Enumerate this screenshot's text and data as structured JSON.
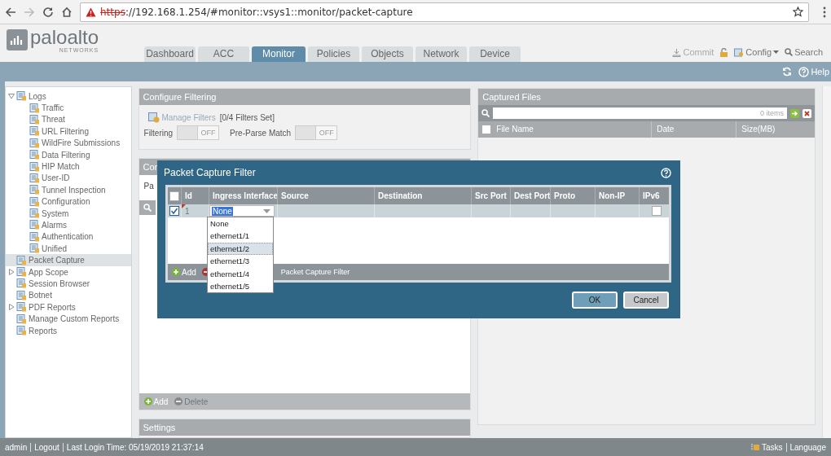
{
  "browser": {
    "url_scheme": "https",
    "url_rest": "://192.168.1.254/#monitor::vsys1::monitor/packet-capture",
    "secure": false
  },
  "header": {
    "logo": "paloalto",
    "logo_sub": "NETWORKS",
    "tabs": [
      {
        "label": "Dashboard",
        "selected": false
      },
      {
        "label": "ACC",
        "selected": false
      },
      {
        "label": "Monitor",
        "selected": true
      },
      {
        "label": "Policies",
        "selected": false
      },
      {
        "label": "Objects",
        "selected": false
      },
      {
        "label": "Network",
        "selected": false
      },
      {
        "label": "Device",
        "selected": false
      }
    ],
    "commit": {
      "label": "Commit",
      "disabled": true
    },
    "config": "Config",
    "search": "Search"
  },
  "help_bar": {
    "help": "Help"
  },
  "sidebar": {
    "items": [
      {
        "label": "Logs",
        "expanded": true,
        "selected": false,
        "children": [
          {
            "label": "Traffic",
            "selected": false
          },
          {
            "label": "Threat",
            "selected": false
          },
          {
            "label": "URL Filtering",
            "selected": false
          },
          {
            "label": "WildFire Submissions",
            "selected": false
          },
          {
            "label": "Data Filtering",
            "selected": false
          },
          {
            "label": "HIP Match",
            "selected": false
          },
          {
            "label": "User-ID",
            "selected": false
          },
          {
            "label": "Tunnel Inspection",
            "selected": false
          },
          {
            "label": "Configuration",
            "selected": false
          },
          {
            "label": "System",
            "selected": false
          },
          {
            "label": "Alarms",
            "selected": false
          },
          {
            "label": "Authentication",
            "selected": false
          },
          {
            "label": "Unified",
            "selected": false
          }
        ]
      },
      {
        "label": "Packet Capture",
        "selected": true
      },
      {
        "label": "App Scope",
        "expanded": false,
        "selected": false
      },
      {
        "label": "Session Browser",
        "selected": false
      },
      {
        "label": "Botnet",
        "selected": false
      },
      {
        "label": "PDF Reports",
        "expanded": false,
        "selected": false
      },
      {
        "label": "Manage Custom Reports",
        "selected": false
      },
      {
        "label": "Reports",
        "selected": false
      }
    ]
  },
  "configure_filtering": {
    "title": "Configure Filtering",
    "manage_filters": "Manage Filters",
    "filters_set": "[0/4 Filters Set]",
    "toggles": [
      {
        "label": "Filtering",
        "state_text": "OFF",
        "on": false
      },
      {
        "label": "Pre-Parse Match",
        "state_text": "OFF",
        "on": false
      }
    ]
  },
  "capture_panel": {
    "title": "Con",
    "label": "Pa",
    "add": "Add",
    "delete": {
      "label": "Delete",
      "disabled": true
    }
  },
  "settings_panel": {
    "title": "Settings"
  },
  "captured_files": {
    "title": "Captured Files",
    "count": "0 items",
    "select_all": false,
    "columns": [
      "File Name",
      "Date",
      "Size(MB)"
    ]
  },
  "dialog": {
    "title": "Packet Capture Filter",
    "select_all": false,
    "columns": [
      "Id",
      "Ingress Interface",
      "Source",
      "Destination",
      "Src Port",
      "Dest Port",
      "Proto",
      "Non-IP",
      "IPv6"
    ],
    "rows": [
      {
        "checked": true,
        "id": "1",
        "ingress": "None",
        "ipv6": false
      }
    ],
    "dropdown": [
      {
        "label": "None",
        "selected": false
      },
      {
        "label": "ethernet1/1",
        "selected": false
      },
      {
        "label": "ethernet1/2",
        "selected": true
      },
      {
        "label": "ethernet1/3",
        "selected": false
      },
      {
        "label": "ethernet1/4",
        "selected": false
      },
      {
        "label": "ethernet1/5",
        "selected": false
      }
    ],
    "add": "Add",
    "caption": "Packet Capture Filter",
    "ok": "OK",
    "cancel": "Cancel"
  },
  "status_bar": {
    "user": "admin",
    "logout": "Logout",
    "last_login": "Last Login Time: 05/19/2019 21:37:14",
    "tasks": "Tasks",
    "language": "Language"
  }
}
